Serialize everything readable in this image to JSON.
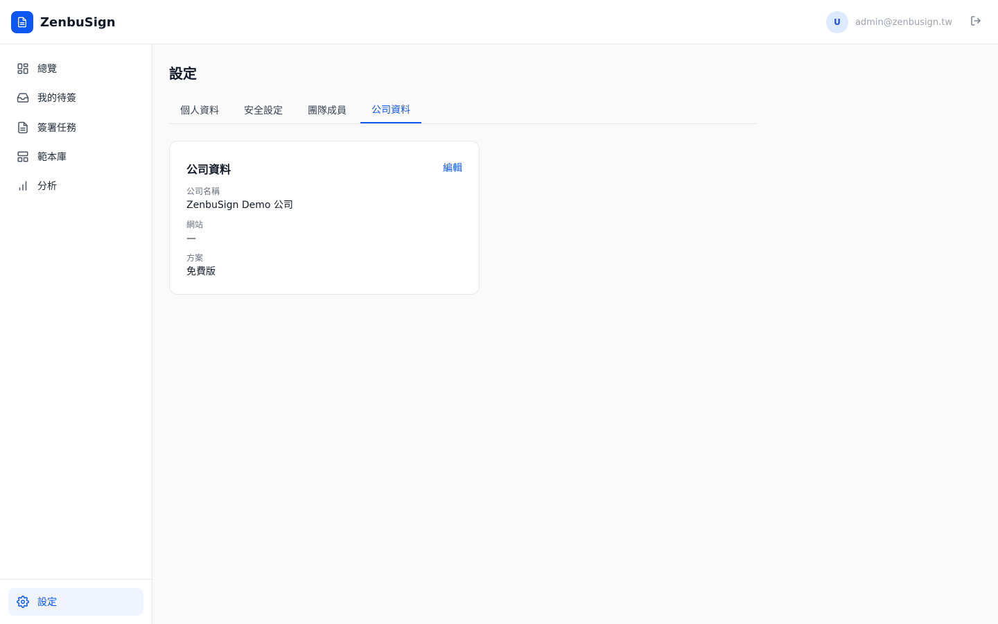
{
  "brand": {
    "name": "ZenbuSign",
    "icon": "document-icon",
    "color": "#0b57f0"
  },
  "user": {
    "initial": "U",
    "email": "admin@zenbusign.tw"
  },
  "sidebar": {
    "items": [
      {
        "label": "總覽",
        "icon": "dashboard-icon"
      },
      {
        "label": "我的待簽",
        "icon": "inbox-icon"
      },
      {
        "label": "簽署任務",
        "icon": "file-text-icon"
      },
      {
        "label": "範本庫",
        "icon": "template-icon"
      },
      {
        "label": "分析",
        "icon": "bar-chart-icon"
      }
    ],
    "settings": {
      "label": "設定",
      "icon": "gear-icon",
      "active": true
    }
  },
  "page": {
    "title": "設定",
    "tabs": [
      {
        "label": "個人資料",
        "active": false
      },
      {
        "label": "安全設定",
        "active": false
      },
      {
        "label": "團隊成員",
        "active": false
      },
      {
        "label": "公司資料",
        "active": true
      }
    ]
  },
  "company_card": {
    "title": "公司資料",
    "edit_label": "編輯",
    "fields": [
      {
        "label": "公司名稱",
        "value": "ZenbuSign Demo 公司"
      },
      {
        "label": "網站",
        "value": "—"
      },
      {
        "label": "方案",
        "value": "免費版"
      }
    ]
  },
  "colors": {
    "accent": "#0b57f0",
    "active_bg": "#eff4ff",
    "border": "#e5e7eb"
  }
}
